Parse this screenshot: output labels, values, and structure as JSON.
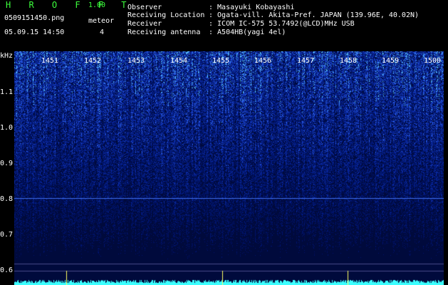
{
  "header": {
    "brand": "H R O F F T",
    "version": "1.00",
    "filename": "0509151450.png",
    "datetime": "05.09.15 14:50",
    "meteor_label": "meteor",
    "meteor_count": "4"
  },
  "info": [
    {
      "label": "Observer",
      "value": ": Masayuki Kobayashi"
    },
    {
      "label": "Receiving Location",
      "value": ": Ogata-vill. Akita-Pref. JAPAN (139.96E, 40.02N)"
    },
    {
      "label": "Receiver",
      "value": ": ICOM IC-575 53.7492(@LCD)MHz USB"
    },
    {
      "label": "Receiving antenna",
      "value": ": A504HB(yagi 4el)"
    }
  ],
  "spectrogram": {
    "unit_label": "kHz",
    "y_ticks": [
      "1.1",
      "1.0",
      "0.9",
      "0.8",
      "0.7",
      "0.6"
    ],
    "time_labels": [
      "1451",
      "1452",
      "1453",
      "1454",
      "1455",
      "1456",
      "1457",
      "1458",
      "1459",
      "1500"
    ]
  },
  "colors": {
    "background": "#000000",
    "brand": "#3cff3c",
    "noise_dark": "#000a3c",
    "noise_bright": "#3a6cff",
    "signal": "#3cffff"
  }
}
